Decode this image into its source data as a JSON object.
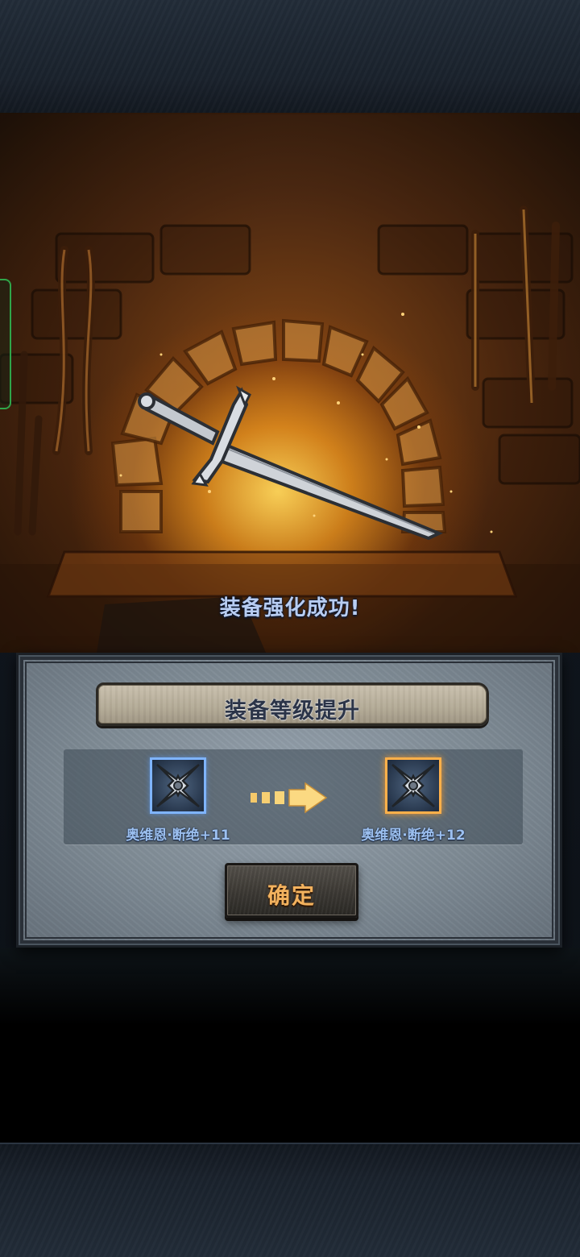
{
  "forge_scene": {
    "message": "装备强化成功!",
    "weapon_icon": "sword-icon"
  },
  "result_panel": {
    "title": "装备等级提升",
    "before_item": {
      "name": "奥维恩·断绝+11",
      "icon": "cross-blade-icon",
      "frame_color": "#7fb4ff"
    },
    "after_item": {
      "name": "奥维恩·断绝+12",
      "icon": "cross-blade-icon",
      "frame_color": "#ffb04a"
    },
    "arrow_icon": "arrow-right-icon",
    "confirm_label": "确定"
  },
  "colors": {
    "message_text": "#b8cdf2",
    "confirm_text": "#f3b25e",
    "item_label": "#9cc0f0"
  }
}
